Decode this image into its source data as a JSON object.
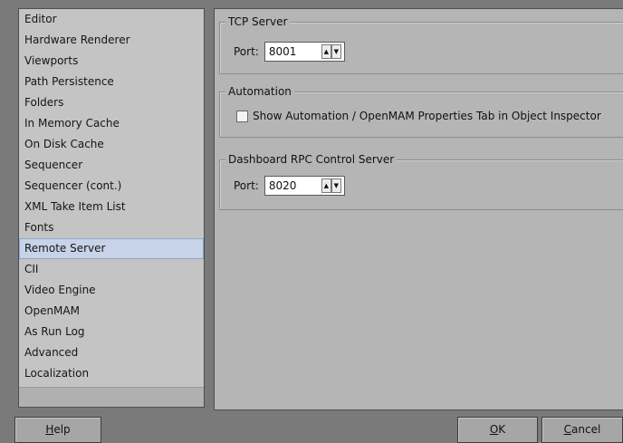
{
  "categories": [
    "Editor",
    "Hardware Renderer",
    "Viewports",
    "Path Persistence",
    "Folders",
    "In Memory Cache",
    "On Disk Cache",
    "Sequencer",
    "Sequencer (cont.)",
    "XML Take Item List",
    "Fonts",
    "Remote Server",
    "CII",
    "Video Engine",
    "OpenMAM",
    "As Run Log",
    "Advanced",
    "Localization"
  ],
  "selected_category": "Remote Server",
  "tcp_server": {
    "title": "TCP Server",
    "port_label": "Port:",
    "port_value": "8001"
  },
  "automation": {
    "title": "Automation",
    "checkbox_label": "Show Automation / OpenMAM Properties Tab in Object Inspector",
    "checked": false
  },
  "dashboard": {
    "title": "Dashboard RPC Control Server",
    "port_label": "Port:",
    "port_value": "8020"
  },
  "spin_icons": {
    "up": "spin-up-arrow-icon",
    "down": "spin-down-arrow-icon"
  },
  "buttons": {
    "help": {
      "mnemonic": "H",
      "rest": "elp"
    },
    "ok": {
      "mnemonic": "O",
      "rest": "K"
    },
    "cancel": {
      "mnemonic": "C",
      "rest": "ancel"
    }
  }
}
